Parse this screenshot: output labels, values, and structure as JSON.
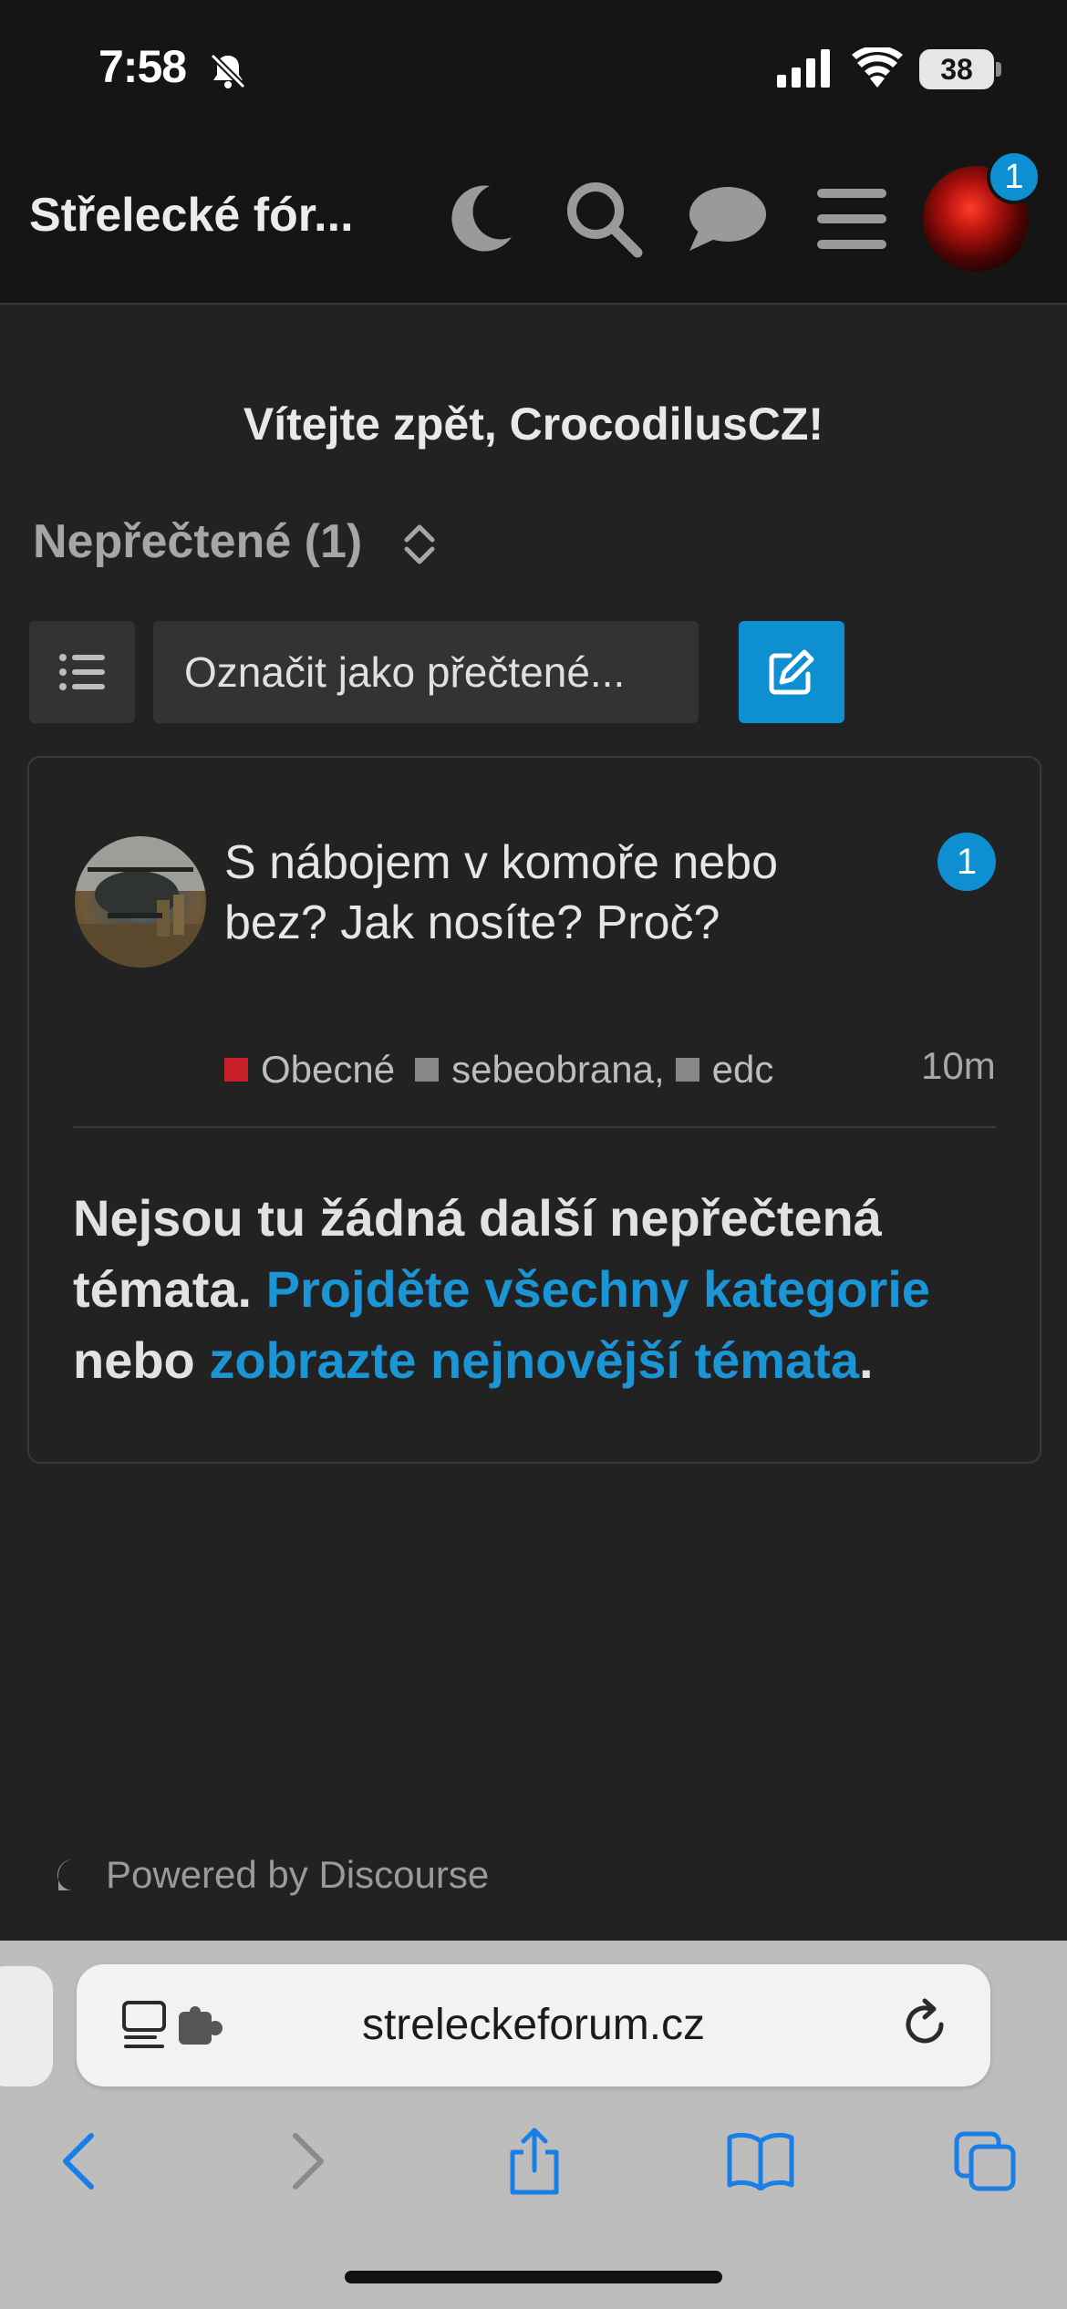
{
  "status_bar": {
    "time": "7:58",
    "battery": "38"
  },
  "header": {
    "site_title": "Střelecké fór...",
    "notification_count": "1"
  },
  "main": {
    "welcome": "Vítejte zpět, CrocodilusCZ!",
    "filter_label": "Nepřečtené (1)",
    "mark_read_label": "Označit jako přečtené...",
    "topic": {
      "title": "S nábojem v komoře nebo bez? Jak nosíte? Proč?",
      "unread": "1",
      "category": {
        "name": "Obecné",
        "color": "#c8202a"
      },
      "tags": [
        "sebeobrana,",
        "edc"
      ],
      "activity": "10m"
    },
    "empty_message": {
      "part1": "Nejsou tu žádná další nepřečtená témata. ",
      "link1": "Projděte všechny kategorie",
      "part2": " nebo ",
      "link2": "zobrazte nejnovější témata",
      "part3": "."
    },
    "powered_by": "Powered by Discourse"
  },
  "browser": {
    "url": "streleckeforum.cz"
  },
  "colors": {
    "accent": "#0e8fd2",
    "background": "#222222",
    "header": "#151515",
    "link": "#1a95d6"
  }
}
